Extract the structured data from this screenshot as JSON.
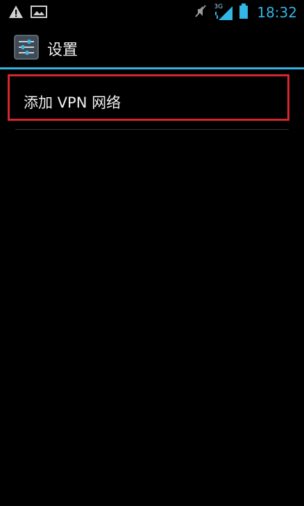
{
  "status_bar": {
    "time": "18:32",
    "network_type": "3G",
    "icons": [
      "warning-icon",
      "picture-icon",
      "mute-icon",
      "signal-icon",
      "battery-icon"
    ]
  },
  "action_bar": {
    "title": "设置",
    "icon": "settings-icon",
    "accent_color": "#33b5e5"
  },
  "list": {
    "items": [
      {
        "label": "添加 VPN 网络"
      }
    ],
    "highlight_color": "#d6272b"
  }
}
